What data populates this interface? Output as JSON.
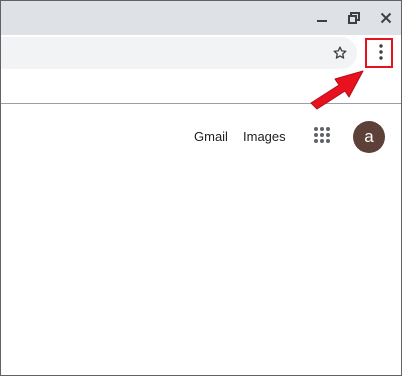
{
  "window": {
    "minimize_icon": "minimize-icon",
    "restore_icon": "restore-icon",
    "close_icon": "close-icon"
  },
  "toolbar": {
    "bookmark_icon": "star-icon",
    "menu_icon": "more-vert-icon"
  },
  "header": {
    "gmail_label": "Gmail",
    "images_label": "Images",
    "apps_icon": "apps-grid-icon",
    "avatar_letter": "a"
  },
  "annotation": {
    "highlight_color": "#e8121e",
    "arrow_color": "#e8121e"
  },
  "colors": {
    "titlebar": "#dee1e6",
    "omnibox": "#f1f3f4",
    "avatar_bg": "#5d4037"
  }
}
